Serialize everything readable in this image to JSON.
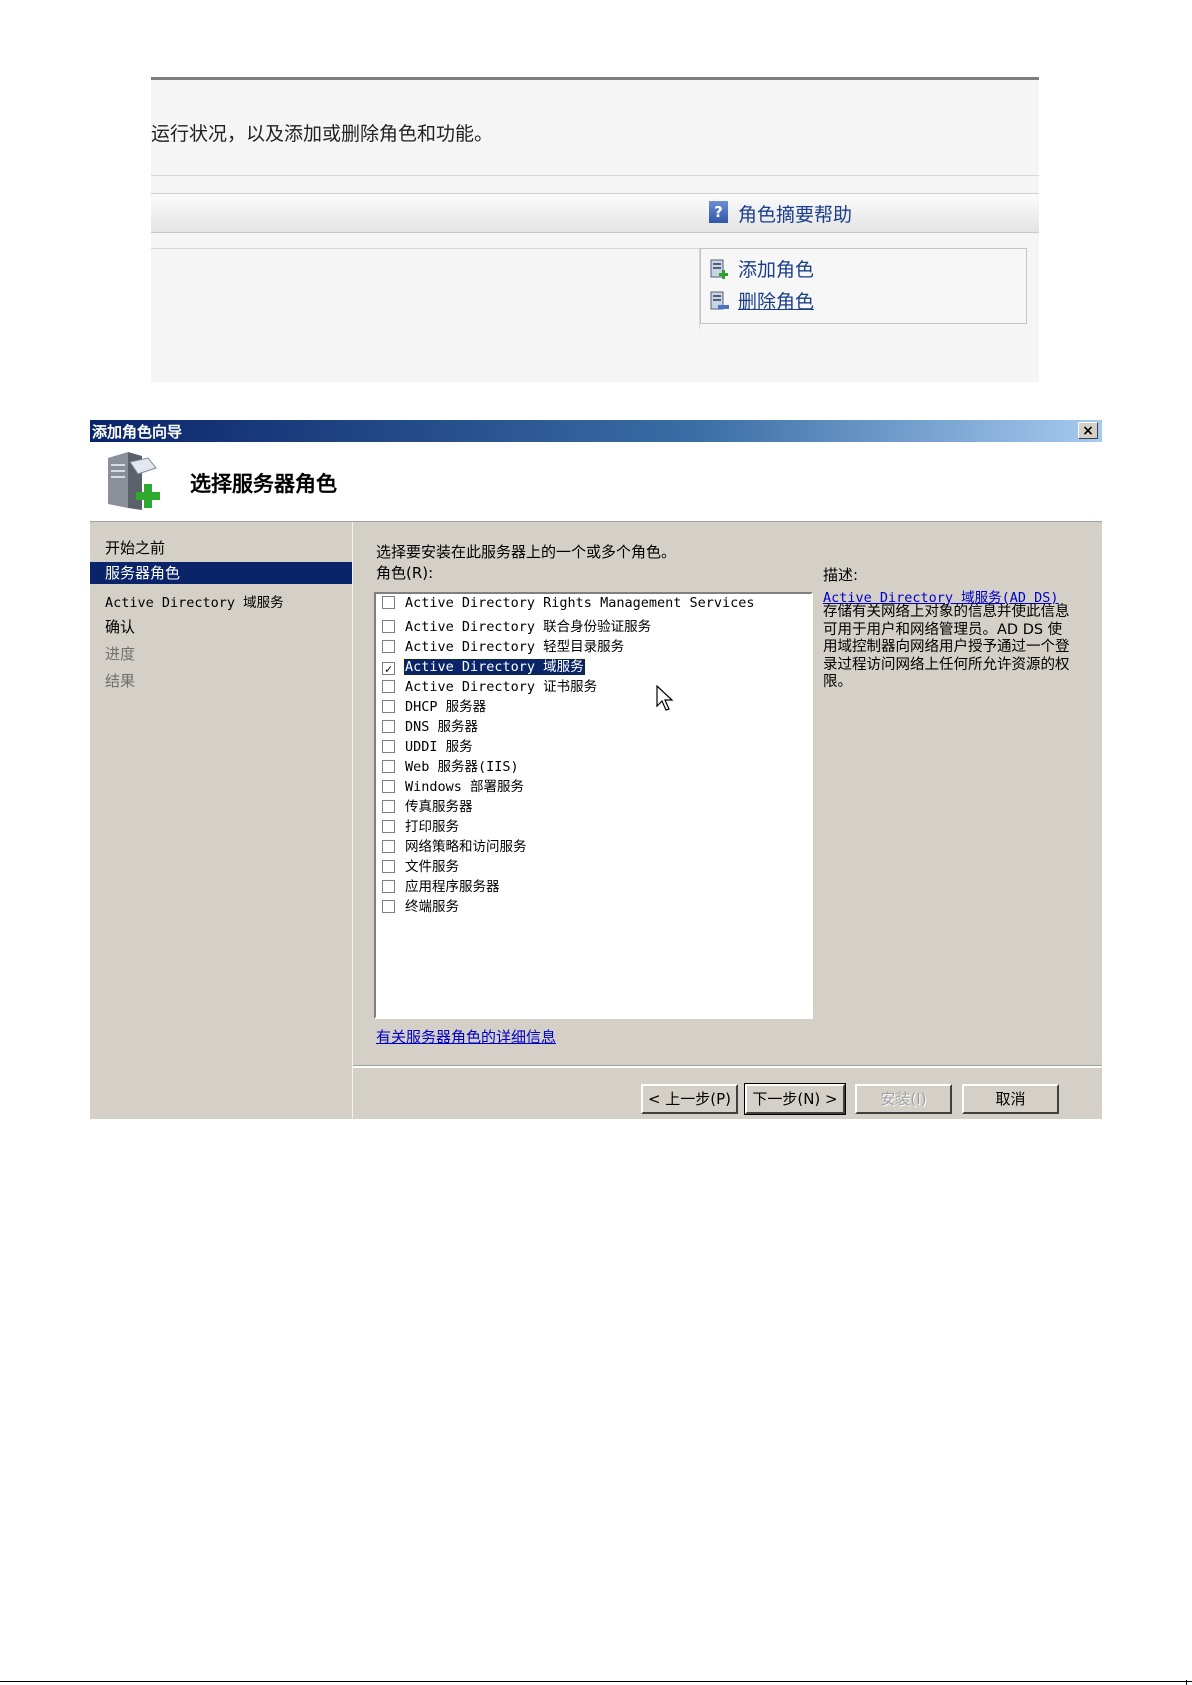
{
  "server_manager": {
    "intro_text": "运行状况，以及添加或删除角色和功能。",
    "help_link": "角色摘要帮助",
    "actions": [
      {
        "label": "添加角色"
      },
      {
        "label": "删除角色"
      }
    ]
  },
  "wizard": {
    "window_title": "添加角色向导",
    "close_label": "×",
    "page_title": "选择服务器角色",
    "nav": [
      {
        "label": "开始之前",
        "state": "normal"
      },
      {
        "label": "服务器角色",
        "state": "selected"
      },
      {
        "label": "Active Directory 域服务",
        "state": "normal"
      },
      {
        "label": "确认",
        "state": "normal"
      },
      {
        "label": "进度",
        "state": "disabled"
      },
      {
        "label": "结果",
        "state": "disabled"
      }
    ],
    "instruction": "选择要安装在此服务器上的一个或多个角色。",
    "roles_label": "角色(R):",
    "roles": [
      {
        "label": "Active Directory Rights Management Services",
        "checked": false
      },
      {
        "label": "Active Directory 联合身份验证服务",
        "checked": false
      },
      {
        "label": "Active Directory 轻型目录服务",
        "checked": false
      },
      {
        "label": "Active Directory 域服务",
        "checked": true
      },
      {
        "label": "Active Directory 证书服务",
        "checked": false
      },
      {
        "label": "DHCP 服务器",
        "checked": false
      },
      {
        "label": "DNS 服务器",
        "checked": false
      },
      {
        "label": "UDDI 服务",
        "checked": false
      },
      {
        "label": "Web 服务器(IIS)",
        "checked": false
      },
      {
        "label": "Windows 部署服务",
        "checked": false
      },
      {
        "label": "传真服务器",
        "checked": false
      },
      {
        "label": "打印服务",
        "checked": false
      },
      {
        "label": "网络策略和访问服务",
        "checked": false
      },
      {
        "label": "文件服务",
        "checked": false
      },
      {
        "label": "应用程序服务器",
        "checked": false
      },
      {
        "label": "终端服务",
        "checked": false
      }
    ],
    "description": {
      "label": "描述:",
      "link": "Active Directory 域服务(AD DS)",
      "text": "存储有关网络上对象的信息并使此信息可用于用户和网络管理员。AD DS 使用域控制器向网络用户授予通过一个登录过程访问网络上任何所允许资源的权限。"
    },
    "more_info_link": "有关服务器角色的详细信息",
    "buttons": {
      "back": "< 上一步(P)",
      "next": "下一步(N) >",
      "install": "安装(I)",
      "cancel": "取消"
    }
  },
  "colors": {
    "titlebar": "#0a246a",
    "dialog_face": "#d4d0c8",
    "link": "#0000cc",
    "selection": "#0a246a"
  }
}
